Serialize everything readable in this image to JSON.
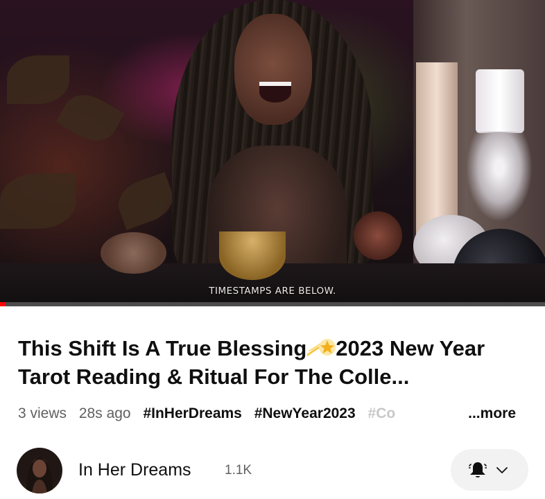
{
  "video": {
    "caption": "TIMESTAMPS ARE BELOW.",
    "progress_fraction": 0.01
  },
  "title": {
    "part1": "This Shift Is A True Blessing",
    "emoji": "dizzy-emoji",
    "part2": "2023 New Year Tarot Reading & Ritual For The Colle..."
  },
  "meta": {
    "views": "3 views",
    "age": "28s ago",
    "tags": [
      "#InHerDreams",
      "#NewYear2023",
      "#Co"
    ],
    "more_label": "...more"
  },
  "channel": {
    "name": "In Her Dreams",
    "subscribers": "1.1K",
    "bell_icon": "bell-icon",
    "chevron_icon": "chevron-down-icon"
  },
  "colors": {
    "progress": "#ff0000",
    "text_primary": "#0f0f0f",
    "text_secondary": "#606060",
    "button_bg": "#f2f2f2"
  }
}
